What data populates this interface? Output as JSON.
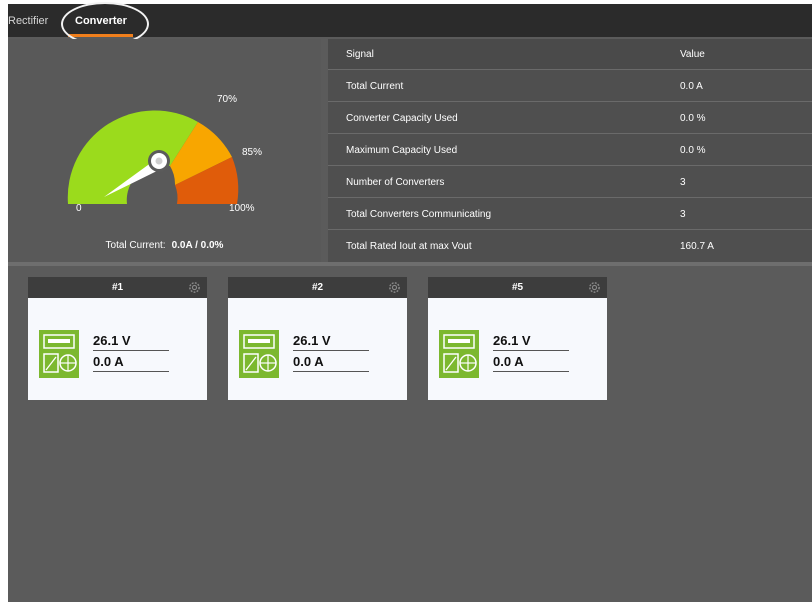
{
  "tabs": [
    {
      "label": "Rectifier",
      "active": false
    },
    {
      "label": "Converter",
      "active": true
    }
  ],
  "gauge": {
    "labels": {
      "zero": "0",
      "seventy": "70%",
      "eightyfive": "85%",
      "hundred": "100%"
    },
    "total_current_label": "Total Current:",
    "total_current_value": "0.0A / 0.0%",
    "level_percent": 0,
    "colors": {
      "green": "#9bdb1c",
      "orange": "#f8a600",
      "red": "#e05c0a",
      "needle": "#ffffff"
    }
  },
  "signals": {
    "header": {
      "signal": "Signal",
      "value": "Value"
    },
    "rows": [
      {
        "signal": "Total Current",
        "value": "0.0 A"
      },
      {
        "signal": "Converter Capacity Used",
        "value": "0.0 %"
      },
      {
        "signal": "Maximum Capacity Used",
        "value": "0.0 %"
      },
      {
        "signal": "Number of Converters",
        "value": "3"
      },
      {
        "signal": "Total Converters Communicating",
        "value": "3"
      },
      {
        "signal": "Total Rated Iout at max Vout",
        "value": "160.7 A"
      }
    ]
  },
  "converters": [
    {
      "id": "#1",
      "voltage": "26.1 V",
      "current": "0.0 A",
      "icon": "converter-icon",
      "settings_icon": "gear-icon"
    },
    {
      "id": "#2",
      "voltage": "26.1 V",
      "current": "0.0 A",
      "icon": "converter-icon",
      "settings_icon": "gear-icon"
    },
    {
      "id": "#5",
      "voltage": "26.1 V",
      "current": "0.0 A",
      "icon": "converter-icon",
      "settings_icon": "gear-icon"
    }
  ]
}
